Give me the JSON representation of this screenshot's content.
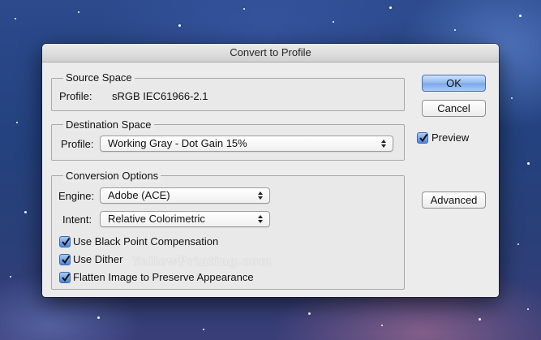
{
  "window": {
    "title": "Convert to Profile"
  },
  "source_space": {
    "legend": "Source Space",
    "profile_label": "Profile:",
    "profile_value": "sRGB IEC61966-2.1"
  },
  "destination_space": {
    "legend": "Destination Space",
    "profile_label": "Profile:",
    "profile_value": "Working Gray - Dot Gain 15%"
  },
  "conversion_options": {
    "legend": "Conversion Options",
    "engine_label": "Engine:",
    "engine_value": "Adobe (ACE)",
    "intent_label": "Intent:",
    "intent_value": "Relative Colorimetric",
    "checkboxes": [
      {
        "label": "Use Black Point Compensation",
        "checked": true
      },
      {
        "label": "Use Dither",
        "checked": true
      },
      {
        "label": "Flatten Image to Preserve Appearance",
        "checked": true
      }
    ]
  },
  "buttons": {
    "ok": "OK",
    "cancel": "Cancel",
    "advanced": "Advanced"
  },
  "preview": {
    "label": "Preview",
    "checked": true
  },
  "watermark": "YellowPrinting.com",
  "colors": {
    "default_button": "#7aa7e9",
    "checkbox_accent": "#4c86de",
    "dialog_bg": "#ececec"
  }
}
